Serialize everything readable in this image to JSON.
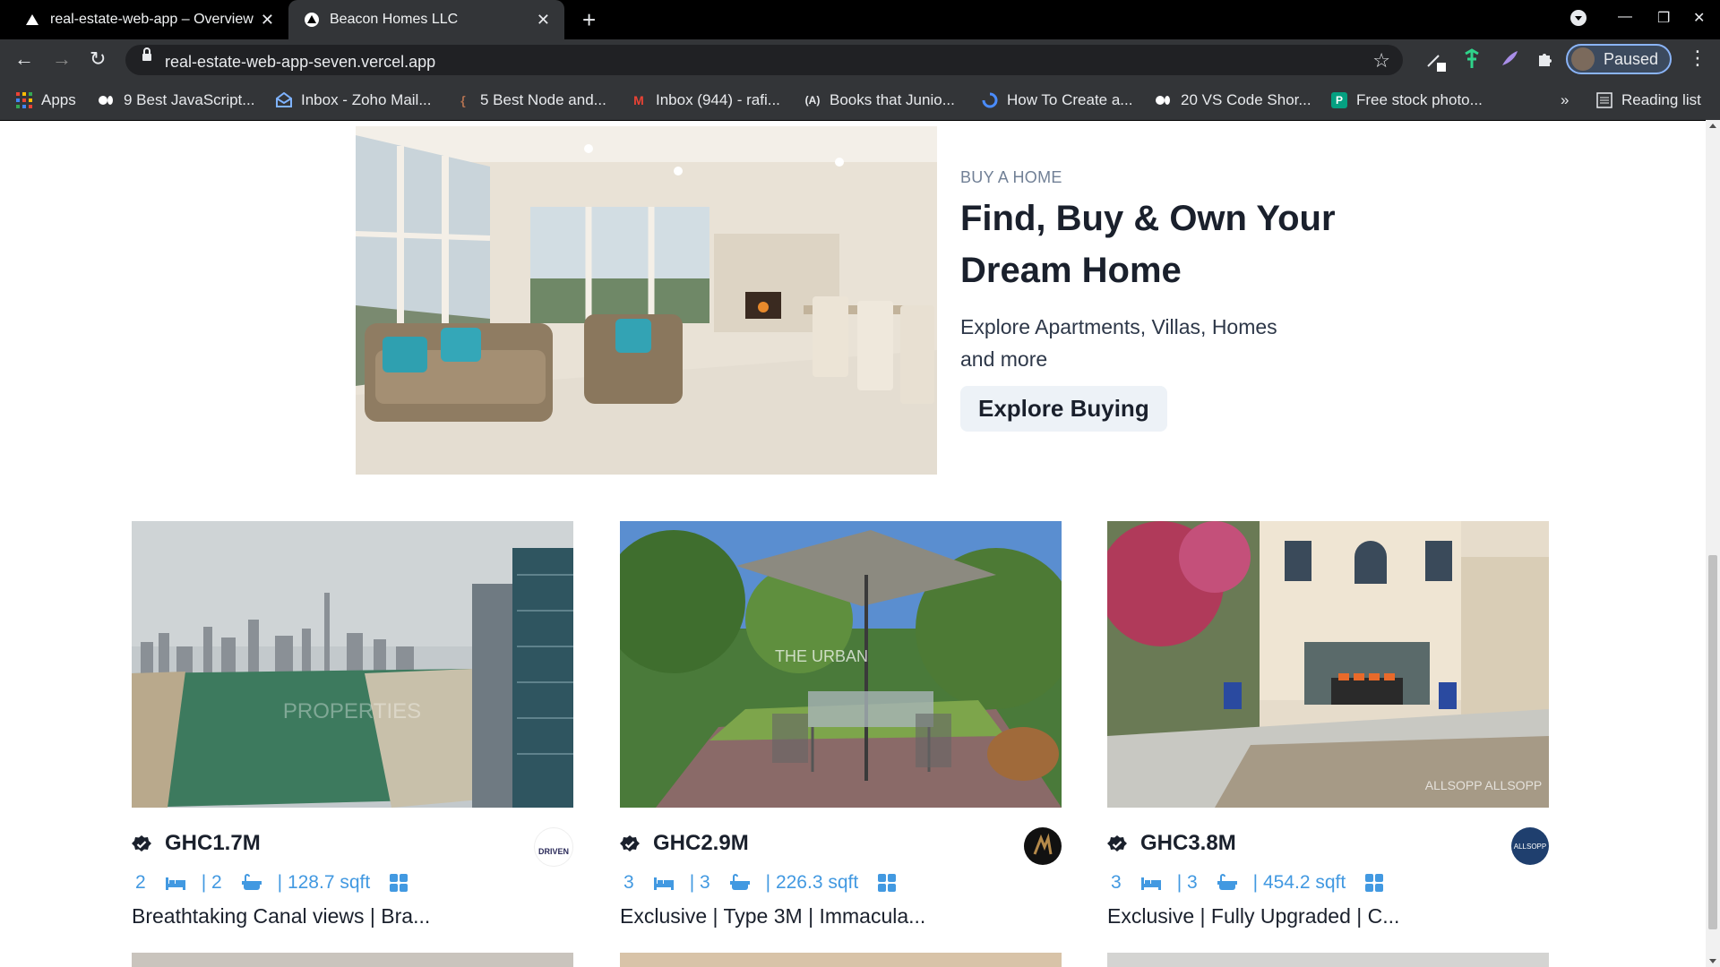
{
  "browser": {
    "tabs": [
      {
        "title": "real-estate-web-app – Overview",
        "active": false
      },
      {
        "title": "Beacon Homes LLC",
        "active": true
      }
    ],
    "url": "real-estate-web-app-seven.vercel.app",
    "profile_label": "Paused",
    "bookmarks": [
      {
        "label": "Apps",
        "icon": "apps-grid-icon"
      },
      {
        "label": "9 Best JavaScript...",
        "icon": "medium-icon"
      },
      {
        "label": "Inbox - Zoho Mail...",
        "icon": "zoho-mail-icon"
      },
      {
        "label": "5 Best Node and...",
        "icon": "bracket-icon"
      },
      {
        "label": "Inbox (944) - rafi...",
        "icon": "gmail-icon"
      },
      {
        "label": "Books that Junio...",
        "icon": "a-logo-icon"
      },
      {
        "label": "How To Create a...",
        "icon": "swirl-icon"
      },
      {
        "label": "20 VS Code Shor...",
        "icon": "medium-icon"
      },
      {
        "label": "Free stock photo...",
        "icon": "pexels-icon"
      }
    ],
    "reading_list": "Reading list",
    "overflow": "»"
  },
  "hero": {
    "eyebrow": "BUY A HOME",
    "title_line1": "Find, Buy & Own Your",
    "title_line2": "Dream Home",
    "desc_line1": "Explore Apartments, Villas, Homes",
    "desc_line2": "and more",
    "cta": "Explore Buying"
  },
  "listings": [
    {
      "price": "GHC1.7M",
      "rooms": "2",
      "baths": "| 2",
      "area": "| 128.7 sqft",
      "title": "Breathtaking Canal views | Bra...",
      "agency_text": "DRIVEN",
      "photo_watermark": "PROPERTIES"
    },
    {
      "price": "GHC2.9M",
      "rooms": "3",
      "baths": "| 3",
      "area": "| 226.3 sqft",
      "title": "Exclusive | Type 3M | Immacula...",
      "agency_text": "",
      "photo_watermark": "THE URBAN"
    },
    {
      "price": "GHC3.8M",
      "rooms": "3",
      "baths": "| 3",
      "area": "| 454.2 sqft",
      "title": "Exclusive | Fully Upgraded | C...",
      "agency_text": "ALLSOPP",
      "photo_watermark": "ALLSOPP ALLSOPP"
    }
  ],
  "colors": {
    "accent_blue": "#4299e1",
    "title": "#1a202c",
    "eyebrow": "#718096",
    "cta_bg": "#edf2f7"
  }
}
